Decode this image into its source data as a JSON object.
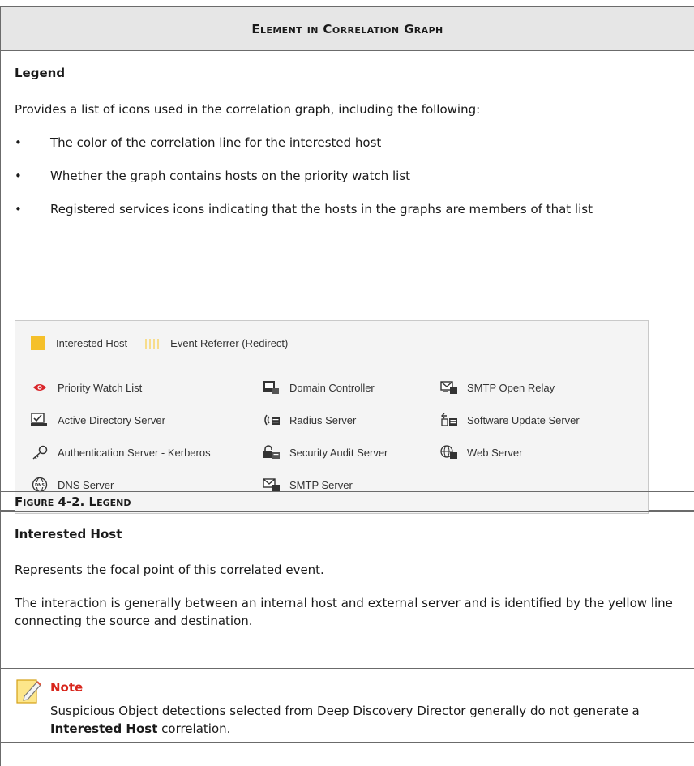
{
  "table": {
    "header": "Element in Correlation Graph"
  },
  "legend_section": {
    "title": "Legend",
    "intro": "Provides a list of icons used in the correlation graph, including the following:",
    "bullets": [
      "The color of the correlation line for the interested host",
      "Whether the graph contains hosts on the priority watch list",
      "Registered services icons indicating that the hosts in the graphs are members of that list"
    ]
  },
  "figure": {
    "top_items": {
      "interested_host": "Interested Host",
      "event_referrer": "Event Referrer (Redirect)"
    },
    "items": [
      {
        "label": "Priority Watch List",
        "icon": "eye-icon"
      },
      {
        "label": "Domain Controller",
        "icon": "domain-controller-icon"
      },
      {
        "label": "SMTP Open Relay",
        "icon": "smtp-open-relay-icon"
      },
      {
        "label": "Active Directory Server",
        "icon": "active-directory-icon"
      },
      {
        "label": "Radius Server",
        "icon": "radius-server-icon"
      },
      {
        "label": "Software Update Server",
        "icon": "software-update-icon"
      },
      {
        "label": "Authentication Server - Kerberos",
        "icon": "key-icon"
      },
      {
        "label": "Security Audit Server",
        "icon": "lock-server-icon"
      },
      {
        "label": "Web Server",
        "icon": "web-server-icon"
      },
      {
        "label": "DNS Server",
        "icon": "dns-globe-icon"
      },
      {
        "label": "SMTP Server",
        "icon": "smtp-server-icon"
      }
    ],
    "caption": "Figure 4-2. Legend",
    "colors": {
      "interested_host": "#f5c02a",
      "event_referrer": "#f7dd8c",
      "priority_eye": "#d9262b"
    }
  },
  "interested_host_section": {
    "title": "Interested Host",
    "p1": "Represents the focal point of this correlated event.",
    "p2": "The interaction is generally between an internal host and external server and is identified by the yellow line connecting the source and destination."
  },
  "note": {
    "title": "Note",
    "text_before": "Suspicious Object detections selected from Deep Discovery Director generally do not generate a ",
    "text_bold": "Interested Host",
    "text_after": " correlation."
  }
}
